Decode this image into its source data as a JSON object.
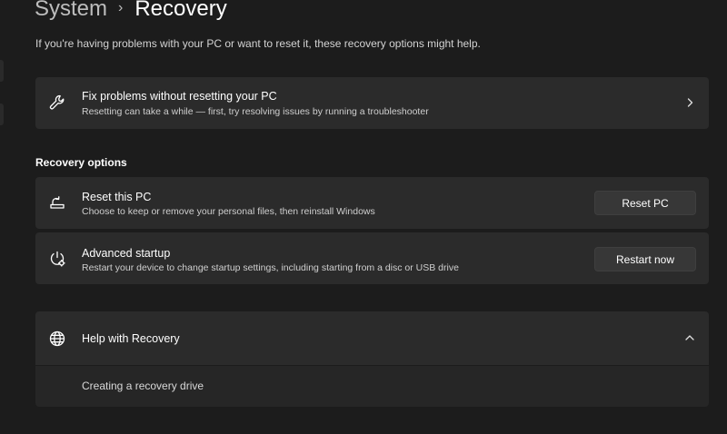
{
  "breadcrumb": {
    "parent": "System",
    "separator": "›",
    "current": "Recovery"
  },
  "description": "If you're having problems with your PC or want to reset it, these recovery options might help.",
  "fix_problems": {
    "title": "Fix problems without resetting your PC",
    "subtitle": "Resetting can take a while — first, try resolving issues by running a troubleshooter",
    "icon": "wrench-icon"
  },
  "recovery_options": {
    "heading": "Recovery options",
    "items": [
      {
        "title": "Reset this PC",
        "subtitle": "Choose to keep or remove your personal files, then reinstall Windows",
        "button": "Reset PC",
        "icon": "reset-pc-icon"
      },
      {
        "title": "Advanced startup",
        "subtitle": "Restart your device to change startup settings, including starting from a disc or USB drive",
        "button": "Restart now",
        "icon": "advanced-startup-icon"
      }
    ]
  },
  "help": {
    "title": "Help with Recovery",
    "icon": "globe-icon",
    "expanded": true,
    "links": [
      "Creating a recovery drive"
    ]
  },
  "colors": {
    "background": "#1c1c1c",
    "card": "#2b2b2b",
    "button": "#373737"
  }
}
